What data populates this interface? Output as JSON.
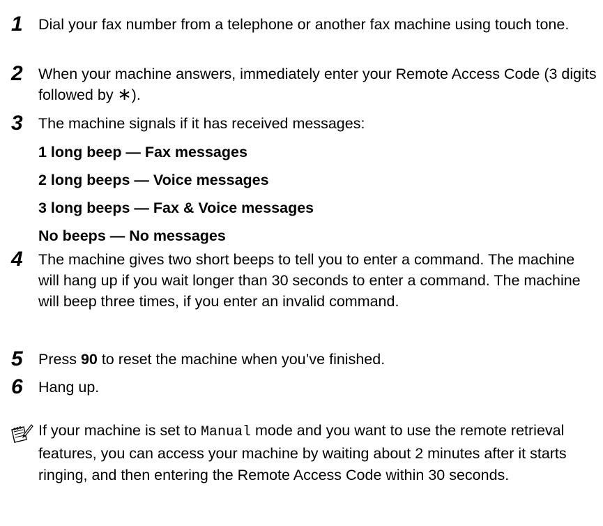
{
  "steps": [
    {
      "number": "1",
      "text": "Dial your fax number from a telephone or another fax machine using touch tone."
    },
    {
      "number": "2",
      "text_before": "When your machine answers, immediately enter your Remote Access Code (3 digits followed by ",
      "symbol": "∗",
      "text_after": ")."
    },
    {
      "number": "3",
      "text": "The machine signals if it has received messages:"
    },
    {
      "number": "4",
      "text": "The machine gives two short beeps to tell you to enter a command. The machine will hang up if you wait longer than 30 seconds to enter a command. The machine will beep three times, if you enter an invalid command."
    },
    {
      "number": "5",
      "text_before": "Press ",
      "bold": "90",
      "text_after": " to reset the machine when you’ve finished."
    },
    {
      "number": "6",
      "text": "Hang up."
    }
  ],
  "signals": [
    "1 long beep — Fax messages",
    "2 long beeps — Voice messages",
    "3 long beeps — Fax & Voice messages",
    "No beeps — No messages"
  ],
  "note": {
    "icon": "note-pencil-icon",
    "text_before": "If your machine is set to ",
    "mono": "Manual",
    "text_after": " mode and you want to use the remote retrieval features, you can access your machine by waiting about 2 minutes after it starts ringing, and then entering the Remote Access Code within 30 seconds."
  }
}
